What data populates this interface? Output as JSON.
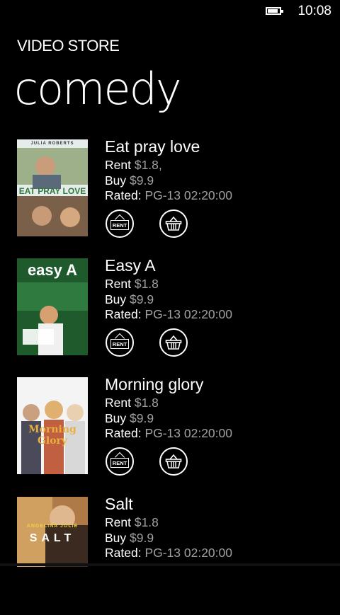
{
  "status": {
    "time": "10:08"
  },
  "app_title": "VIDEO STORE",
  "page_title": "comedy",
  "labels": {
    "rent": "Rent",
    "buy": "Buy",
    "rated": "Rated:",
    "rent_icon_text": "RENT"
  },
  "movies": [
    {
      "title": "Eat pray love",
      "rent": "$1.8,",
      "buy": "$9.9",
      "rating": "PG-13 02:20:00",
      "poster": {
        "top_text": "JULIA ROBERTS",
        "main_text": "EAT PRAY LOVE",
        "colors": [
          "#dfe7ea",
          "#7a9a6a",
          "#c9a07a",
          "#6f5a44"
        ]
      }
    },
    {
      "title": "Easy A",
      "rent": "$1.8",
      "buy": "$9.9",
      "rating": "PG-13 02:20:00",
      "poster": {
        "main_text": "easy A",
        "colors": [
          "#1f5e2e",
          "#2f7a3f",
          "#c8a060",
          "#234d2a"
        ]
      }
    },
    {
      "title": "Morning glory",
      "rent": "$1.8",
      "buy": "$9.9",
      "rating": "PG-13 02:20:00",
      "poster": {
        "main_text": "Morning Glory",
        "colors": [
          "#f3f3f3",
          "#c09a60",
          "#e0b050",
          "#d4d4d4"
        ]
      }
    },
    {
      "title": "Salt",
      "rent": "$1.8",
      "buy": "$9.9",
      "rating": "PG-13 02:20:00",
      "poster": {
        "top_text": "ANGELINA JOLIE",
        "main_text": "SALT",
        "colors": [
          "#8a6a40",
          "#c08a50",
          "#6a4a30",
          "#f0c080"
        ]
      }
    }
  ]
}
